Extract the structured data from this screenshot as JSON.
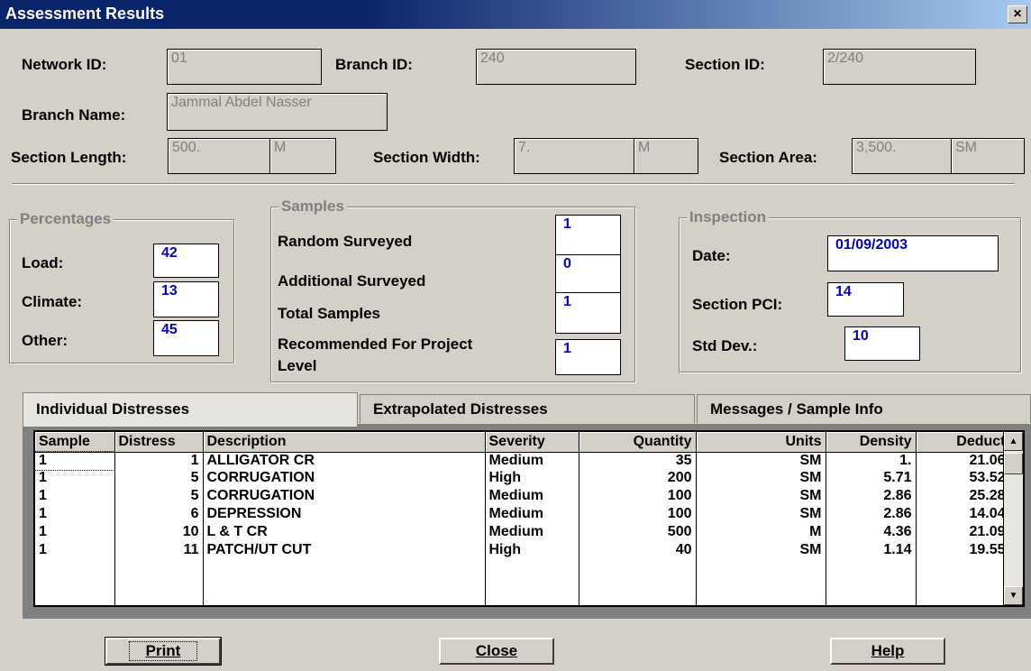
{
  "window": {
    "title": "Assessment Results",
    "close_glyph": "×"
  },
  "section_info": {
    "network_id": {
      "label": "Network ID:",
      "value": "01"
    },
    "branch_id": {
      "label": "Branch ID:",
      "value": "240"
    },
    "section_id": {
      "label": "Section ID:",
      "value": "2/240"
    },
    "branch_name": {
      "label": "Branch Name:",
      "value": "Jammal Abdel Nasser"
    },
    "section_length": {
      "label": "Section Length:",
      "value": "500.",
      "unit": "M"
    },
    "section_width": {
      "label": "Section Width:",
      "value": "7.",
      "unit": "M"
    },
    "section_area": {
      "label": "Section Area:",
      "value": "3,500.",
      "unit": "SM"
    }
  },
  "percentages": {
    "title": "Percentages",
    "load": {
      "label": "Load:",
      "value": "42"
    },
    "climate": {
      "label": "Climate:",
      "value": "13"
    },
    "other": {
      "label": "Other:",
      "value": "45"
    }
  },
  "samples": {
    "title": "Samples",
    "random": {
      "label": "Random Surveyed",
      "value": "1"
    },
    "additional": {
      "label": "Additional Surveyed",
      "value": "0"
    },
    "total": {
      "label": "Total Samples",
      "value": "1"
    },
    "recommended": {
      "label_line1": "Recommended For Project",
      "label_line2": "Level",
      "value": "1"
    }
  },
  "inspection": {
    "title": "Inspection",
    "date": {
      "label": "Date:",
      "value": "01/09/2003"
    },
    "pci": {
      "label": "Section PCI:",
      "value": "14"
    },
    "std_dev": {
      "label": "Std Dev.:",
      "value": "10"
    }
  },
  "tabs": [
    {
      "label": "Individual Distresses",
      "active": true
    },
    {
      "label": "Extrapolated Distresses",
      "active": false
    },
    {
      "label": "Messages / Sample Info",
      "active": false
    }
  ],
  "grid": {
    "columns": [
      "Sample",
      "Distress",
      "Description",
      "Severity",
      "Quantity",
      "Units",
      "Density",
      "Deduct"
    ],
    "rows": [
      [
        "1",
        "1",
        "ALLIGATOR CR",
        "Medium",
        "35",
        "SM",
        "1.",
        "21.06"
      ],
      [
        "1",
        "5",
        "CORRUGATION",
        "High",
        "200",
        "SM",
        "5.71",
        "53.52"
      ],
      [
        "1",
        "5",
        "CORRUGATION",
        "Medium",
        "100",
        "SM",
        "2.86",
        "25.28"
      ],
      [
        "1",
        "6",
        "DEPRESSION",
        "Medium",
        "100",
        "SM",
        "2.86",
        "14.04"
      ],
      [
        "1",
        "10",
        "L & T CR",
        "Medium",
        "500",
        "M",
        "4.36",
        "21.09"
      ],
      [
        "1",
        "11",
        "PATCH/UT CUT",
        "High",
        "40",
        "SM",
        "1.14",
        "19.55"
      ]
    ]
  },
  "buttons": {
    "print": "Print",
    "close": "Close",
    "help": "Help"
  },
  "scroll": {
    "up_icon": "▲",
    "down_icon": "▼"
  }
}
